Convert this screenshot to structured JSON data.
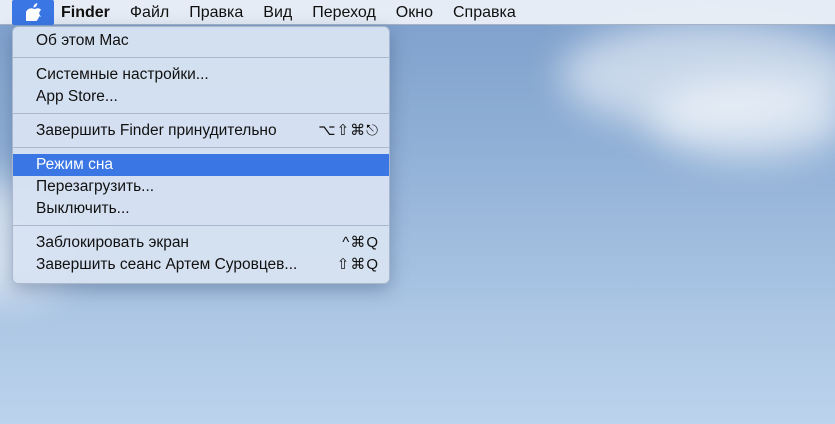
{
  "menubar": {
    "app_name": "Finder",
    "items": [
      "Файл",
      "Правка",
      "Вид",
      "Переход",
      "Окно",
      "Справка"
    ]
  },
  "apple_menu": {
    "about": {
      "label": "Об этом Mac"
    },
    "system_prefs": {
      "label": "Системные настройки..."
    },
    "app_store": {
      "label": "App Store..."
    },
    "force_quit": {
      "label": "Завершить Finder принудительно",
      "shortcut": "⌥⇧⌘⎋"
    },
    "sleep": {
      "label": "Режим сна",
      "highlighted": true
    },
    "restart": {
      "label": "Перезагрузить..."
    },
    "shutdown": {
      "label": "Выключить..."
    },
    "lock_screen": {
      "label": "Заблокировать экран",
      "shortcut": "^⌘Q"
    },
    "log_out": {
      "label": "Завершить сеанс Артем Суровцев...",
      "shortcut": "⇧⌘Q"
    }
  },
  "colors": {
    "highlight": "#3a76e4",
    "menu_bg": "#d6e2f1",
    "desktop": "#90b0d6"
  },
  "icons": {
    "apple_menu": "apple-logo-icon"
  }
}
